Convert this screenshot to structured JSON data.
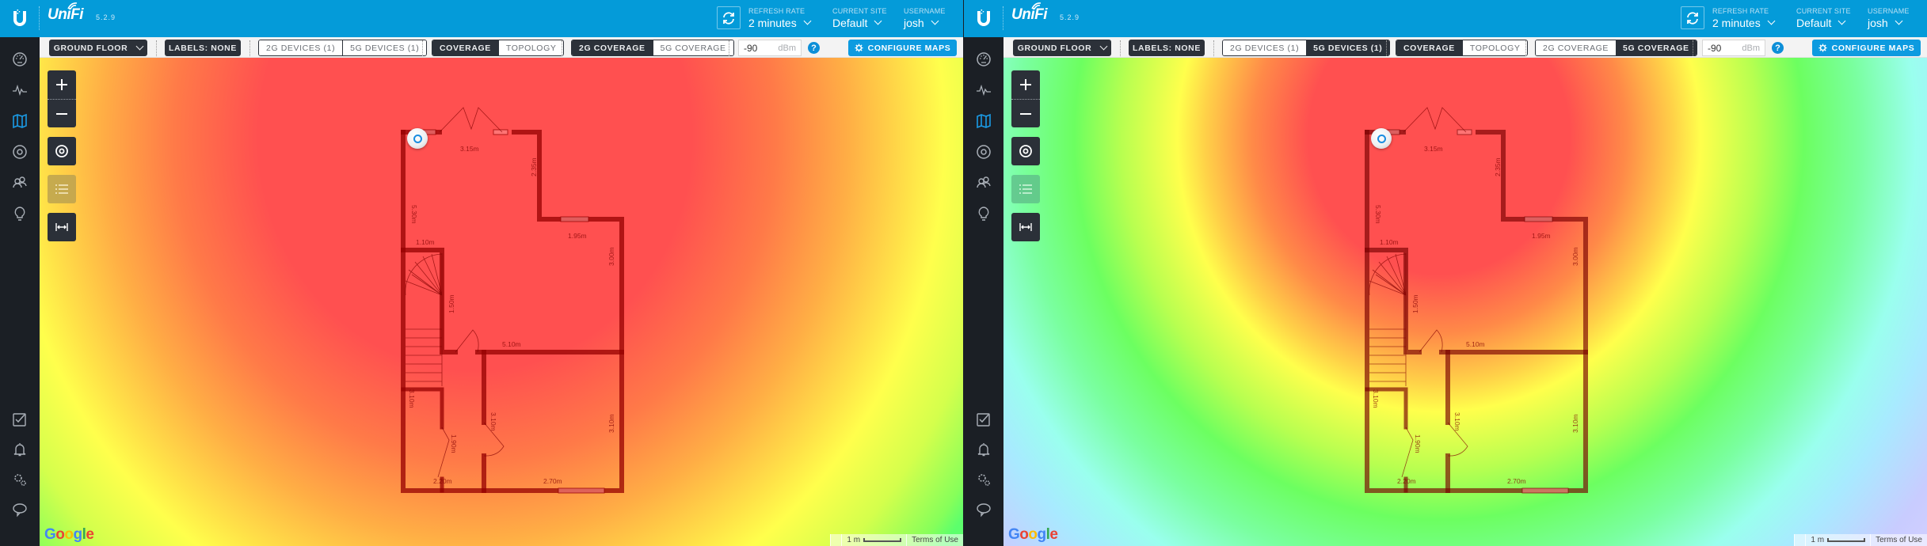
{
  "app": {
    "brand": "UniFi",
    "version": "5.2.9"
  },
  "header": {
    "refresh_rate_label": "REFRESH RATE",
    "refresh_rate_value": "2 minutes",
    "current_site_label": "CURRENT SITE",
    "current_site_value": "Default",
    "username_label": "USERNAME",
    "username_value": "josh"
  },
  "sidebar": {
    "items": [
      {
        "name": "dashboard",
        "icon": "speedometer-icon"
      },
      {
        "name": "statistics",
        "icon": "pulse-icon"
      },
      {
        "name": "map",
        "icon": "map-icon",
        "active": true
      },
      {
        "name": "devices",
        "icon": "target-icon"
      },
      {
        "name": "clients",
        "icon": "users-icon"
      },
      {
        "name": "insights",
        "icon": "lightbulb-icon"
      }
    ],
    "bottom_items": [
      {
        "name": "events",
        "icon": "checkbox-icon"
      },
      {
        "name": "alerts",
        "icon": "bell-icon"
      },
      {
        "name": "settings",
        "icon": "gears-icon"
      },
      {
        "name": "support",
        "icon": "chat-icon"
      }
    ]
  },
  "toolbar": {
    "floor_select": "GROUND FLOOR",
    "labels_button": "LABELS: NONE",
    "devices_2g": "2G DEVICES (1)",
    "devices_5g": "5G DEVICES (1)",
    "view_coverage": "COVERAGE",
    "view_topology": "TOPOLOGY",
    "coverage_2g": "2G COVERAGE",
    "coverage_5g": "5G COVERAGE",
    "dbm_value": "-90",
    "dbm_unit": "dBm",
    "help_label": "?",
    "configure_maps": "CONFIGURE MAPS"
  },
  "map": {
    "footer_brand": "Google",
    "scale_label": "1 m",
    "terms": "Terms of Use",
    "dimension_labels": [
      "3.15m",
      "2.35m",
      "1.95m",
      "5.30m",
      "1.10m",
      "3.00m",
      "1.50m",
      "5.10m",
      "3.10m",
      "3.10m",
      "3.10m",
      "1.90m",
      "2.20m",
      "2.70m"
    ]
  },
  "panels": [
    {
      "id": "left",
      "selected_devices": "2G",
      "selected_view": "COVERAGE",
      "selected_coverage": "2G",
      "heat_scheme": "2g"
    },
    {
      "id": "right",
      "selected_devices": "5G",
      "selected_view": "COVERAGE",
      "selected_coverage": "5G",
      "heat_scheme": "5g"
    }
  ],
  "colors": {
    "header_blue": "#049bd9",
    "sidebar_dark": "#1b1f25",
    "active_icon": "#1a9be6",
    "button_dark": "#2c3139",
    "configure_blue": "#0d9be0",
    "list_btn_2g": "#b9a050",
    "list_btn_5g": "#5fbf8a"
  }
}
